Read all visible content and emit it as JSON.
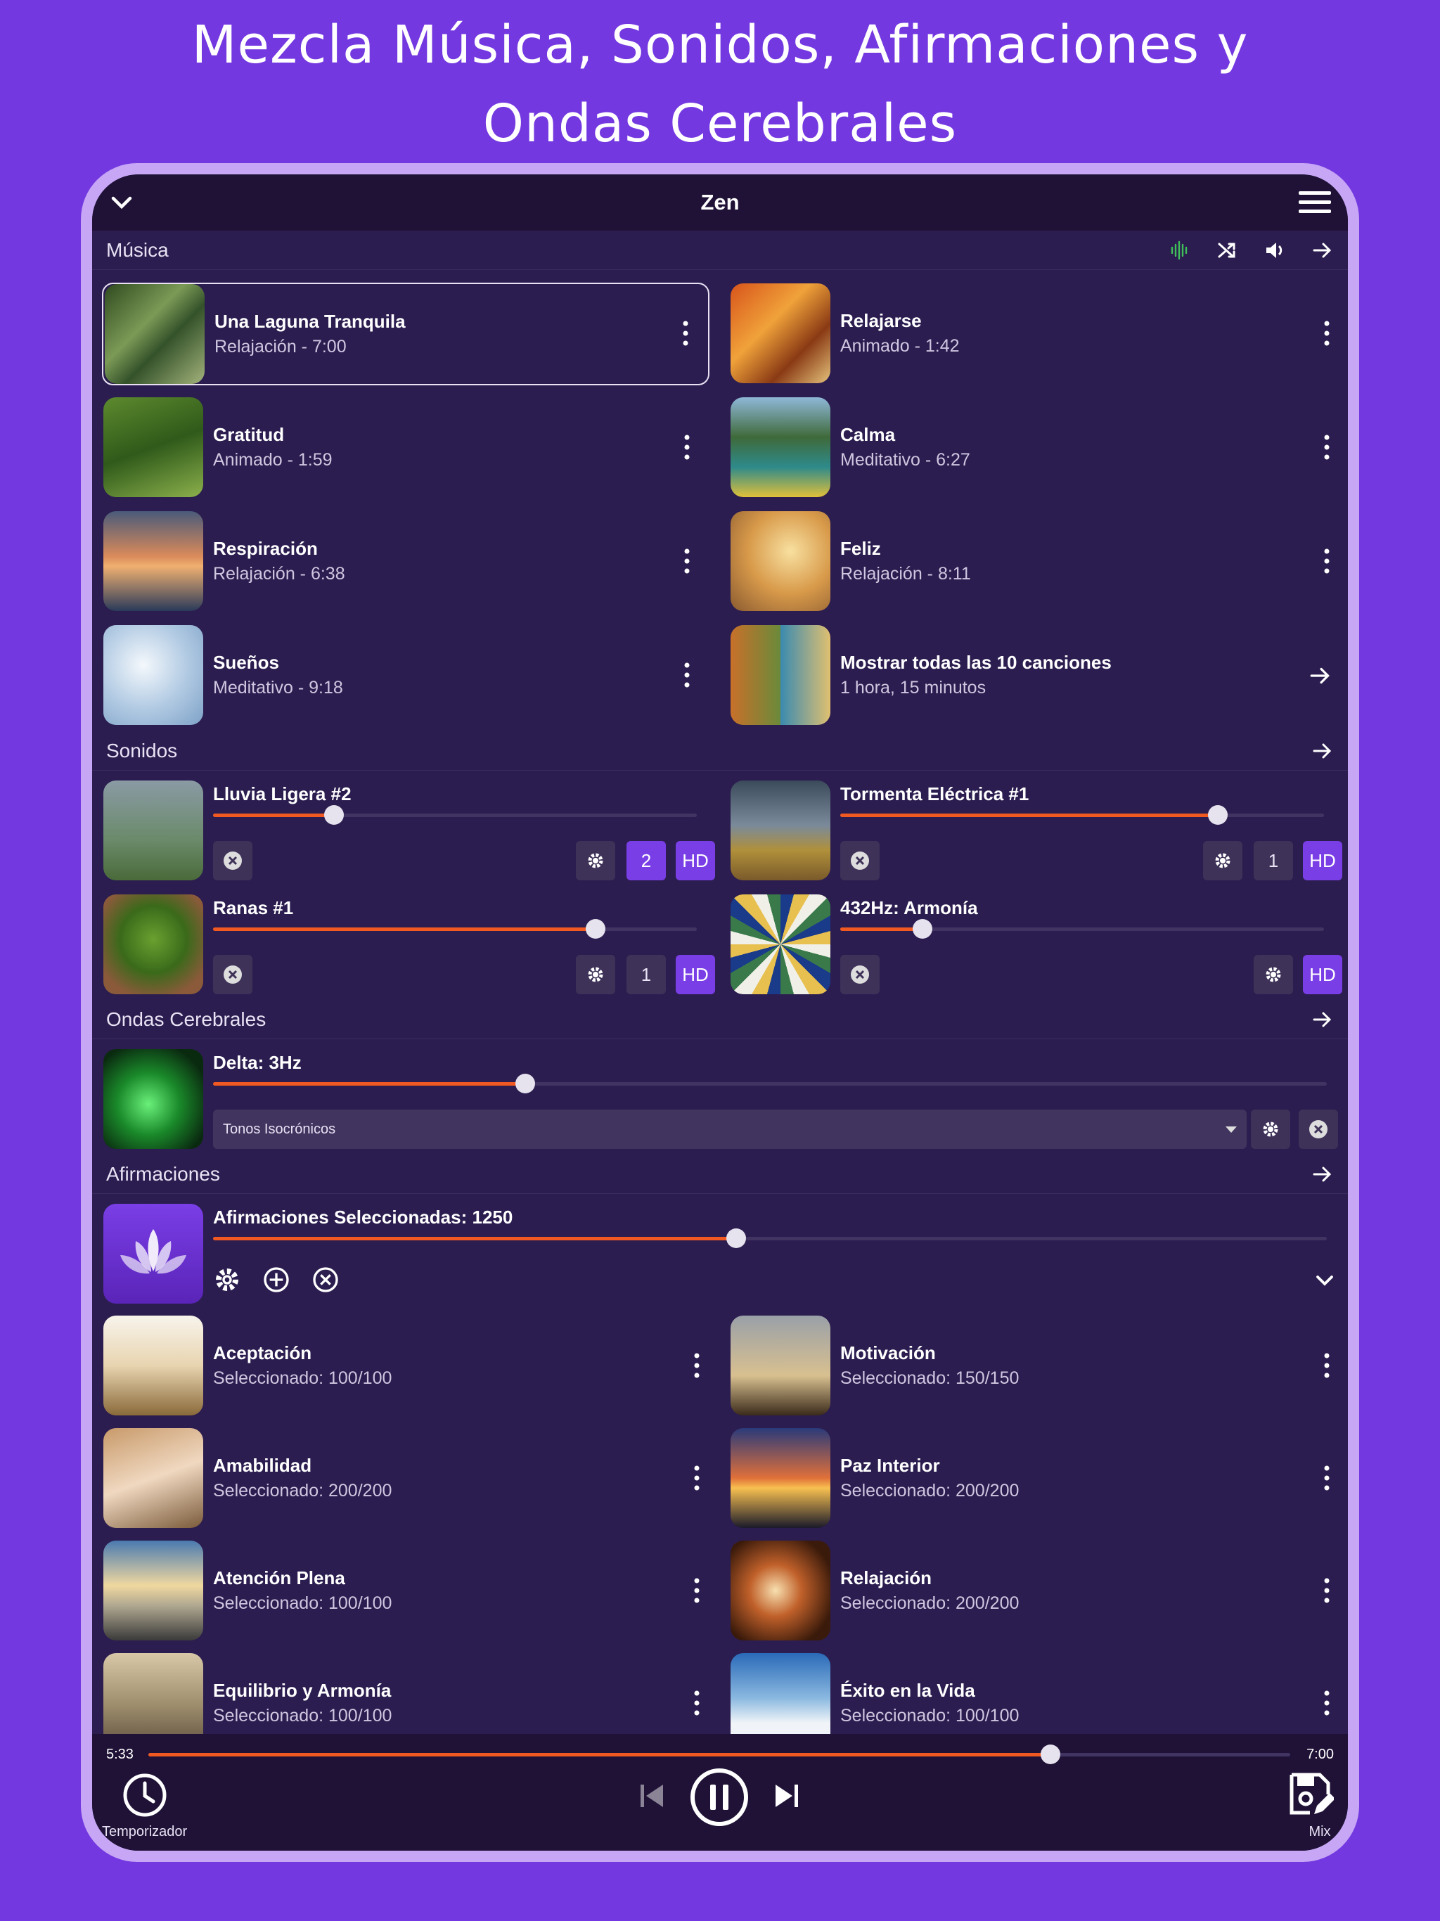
{
  "headline": {
    "line1": "Mezcla Música, Sonidos, Afirmaciones y",
    "line2": "Ondas Cerebrales"
  },
  "topbar": {
    "title": "Zen"
  },
  "sections": {
    "music": "Música",
    "sounds": "Sonidos",
    "brainwaves": "Ondas Cerebrales",
    "affirmations": "Afirmaciones"
  },
  "music": [
    {
      "title": "Una Laguna Tranquila",
      "sub": "Relajación - 7:00"
    },
    {
      "title": "Relajarse",
      "sub": "Animado - 1:42"
    },
    {
      "title": "Gratitud",
      "sub": "Animado - 1:59"
    },
    {
      "title": "Calma",
      "sub": "Meditativo - 6:27"
    },
    {
      "title": "Respiración",
      "sub": "Relajación - 6:38"
    },
    {
      "title": "Feliz",
      "sub": "Relajación - 8:11"
    },
    {
      "title": "Sueños",
      "sub": "Meditativo - 9:18"
    },
    {
      "title": "Mostrar todas las 10 canciones",
      "sub": "1 hora, 15 minutos"
    }
  ],
  "sounds": [
    {
      "title": "Lluvia Ligera #2",
      "level": 0.25,
      "count": "2",
      "hd": "HD"
    },
    {
      "title": "Tormenta Eléctrica #1",
      "level": 0.78,
      "count": "1",
      "hd": "HD"
    },
    {
      "title": "Ranas #1",
      "level": 0.79,
      "count": "1",
      "hd": "HD"
    },
    {
      "title": "432Hz: Armonía",
      "level": 0.17,
      "hd": "HD"
    }
  ],
  "brainwave": {
    "title": "Delta: 3Hz",
    "level": 0.28,
    "mode": "Tonos Isocrónicos"
  },
  "affirmations": {
    "title": "Afirmaciones Seleccionadas: 1250",
    "level": 0.47,
    "items": [
      {
        "title": "Aceptación",
        "sub": "Seleccionado: 100/100"
      },
      {
        "title": "Motivación",
        "sub": "Seleccionado: 150/150"
      },
      {
        "title": "Amabilidad",
        "sub": "Seleccionado: 200/200"
      },
      {
        "title": "Paz Interior",
        "sub": "Seleccionado: 200/200"
      },
      {
        "title": "Atención Plena",
        "sub": "Seleccionado: 100/100"
      },
      {
        "title": "Relajación",
        "sub": "Seleccionado: 200/200"
      },
      {
        "title": "Equilibrio y Armonía",
        "sub": "Seleccionado: 100/100"
      },
      {
        "title": "Éxito en la Vida",
        "sub": "Seleccionado: 100/100"
      }
    ]
  },
  "player": {
    "elapsed": "5:33",
    "total": "7:00",
    "progress": 0.79,
    "timer_label": "Temporizador",
    "mix_label": "Mix"
  },
  "colors": {
    "accent": "#7a3ee6",
    "slider": "#f05a22",
    "background": "#2b1d4f",
    "page": "#7438e0"
  }
}
